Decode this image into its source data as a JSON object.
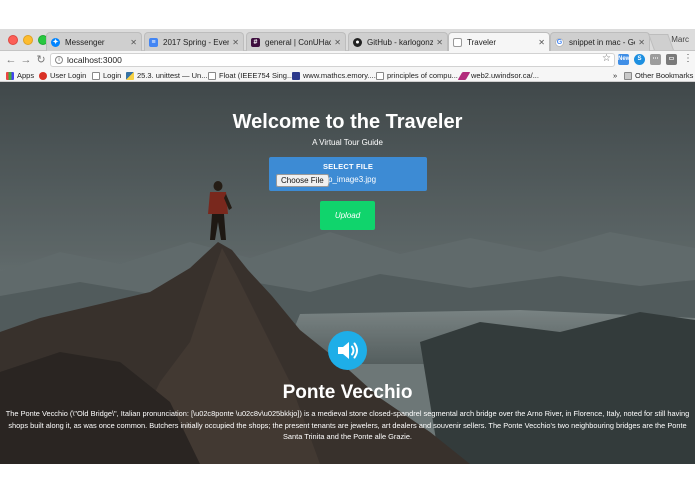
{
  "browser": {
    "tabs": [
      {
        "label": "Messenger",
        "icon": "messenger-icon",
        "color": "#0084ff",
        "active": false
      },
      {
        "label": "2017 Spring - Everythi",
        "icon": "google-docs-icon",
        "color": "#4285f4",
        "active": false
      },
      {
        "label": "general | ConUHacks II",
        "icon": "slack-icon",
        "color": "#3f0f3f",
        "active": false
      },
      {
        "label": "GitHub - karlogonzales",
        "icon": "github-icon",
        "color": "#222222",
        "active": false
      },
      {
        "label": "Traveler",
        "icon": "page-icon",
        "color": "#ffffff",
        "active": true
      },
      {
        "label": "snippet in mac - Googl",
        "icon": "google-icon",
        "color": "#ffffff",
        "active": false
      }
    ],
    "profile_name": "Marc",
    "address": "localhost:3000",
    "extensions": {
      "new_badge": "New"
    },
    "bookmarks": [
      {
        "label": "Apps",
        "icon": "apps-grid-icon"
      },
      {
        "label": "User Login",
        "icon": "login-icon"
      },
      {
        "label": "Login",
        "icon": "page-icon"
      },
      {
        "label": "25.3. unittest — Un...",
        "icon": "python-icon"
      },
      {
        "label": "Float (IEEE754 Sing...",
        "icon": "page-icon"
      },
      {
        "label": "www.mathcs.emory....",
        "icon": "shield-icon"
      },
      {
        "label": "principles of compu...",
        "icon": "page-icon"
      },
      {
        "label": "web2.uwindsor.ca/...",
        "icon": "feather-icon"
      }
    ],
    "more_bookmarks": "»",
    "other_bookmarks": "Other Bookmarks"
  },
  "page": {
    "title": "Welcome to the Traveler",
    "subtitle": "A Virtual Tour Guide",
    "upload": {
      "label": "SELECT FILE",
      "choose_button": "Choose File",
      "filename": "p_image3.jpg",
      "submit_label": "Upload"
    },
    "result": {
      "name": "Ponte Vecchio",
      "description": "The Ponte Vecchio (\\\"Old Bridge\\\", Italian pronunciation: [\\u02c8ponte \\u02c8v\\u025bkkjo]) is a medieval stone closed-spandrel segmental arch bridge over the Arno River, in Florence, Italy, noted for still having shops built along it, as was once common. Butchers initially occupied the shops; the present tenants are jewelers, art dealers and souvenir sellers. The Ponte Vecchio's two neighbouring bridges are the Ponte Santa Trinita and the Ponte alle Grazie."
    }
  },
  "colors": {
    "upload_box": "#3d8bd4",
    "upload_button": "#10d46c",
    "speaker_button": "#1eaee8"
  }
}
